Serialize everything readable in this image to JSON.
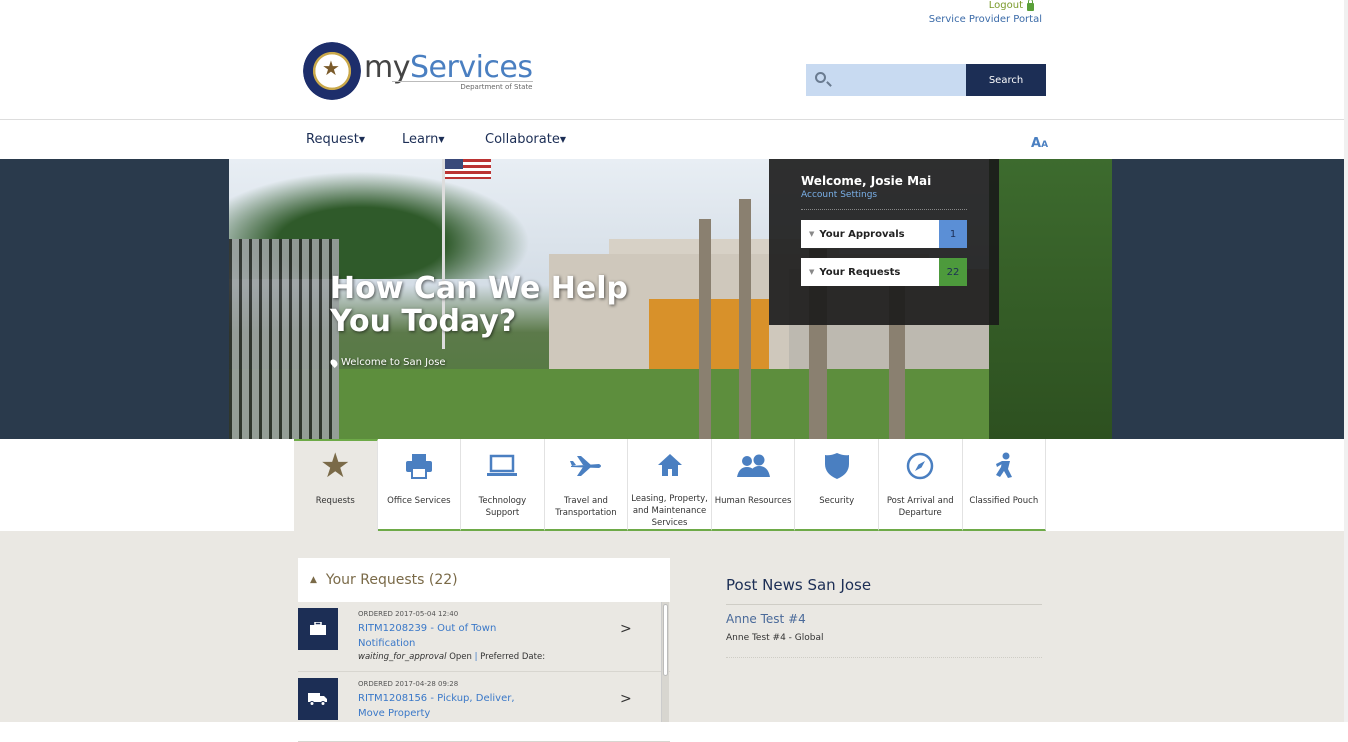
{
  "header": {
    "logout_label": "Logout",
    "service_provider_label": "Service Provider Portal",
    "brand_my": "my",
    "brand_services": "Services",
    "brand_sub": "Department of State",
    "search_placeholder": "",
    "search_button": "Search"
  },
  "nav": {
    "items": [
      {
        "label": "Request"
      },
      {
        "label": "Learn"
      },
      {
        "label": "Collaborate"
      }
    ],
    "font_size_label_big": "A",
    "font_size_label_small": "A"
  },
  "hero": {
    "title": "How Can We Help You Today?",
    "location": "Welcome to San Jose"
  },
  "welcome": {
    "greeting": "Welcome, Josie Mai",
    "account_settings": "Account Settings",
    "approvals_label": "Your Approvals",
    "approvals_count": "1",
    "approvals_color": "#5b8fd6",
    "requests_label": "Your Requests",
    "requests_count": "22",
    "requests_color": "#4d9a3c"
  },
  "categories": [
    {
      "label": "Requests",
      "icon": "star-icon"
    },
    {
      "label": "Office Services",
      "icon": "printer-icon"
    },
    {
      "label": "Technology Support",
      "icon": "laptop-icon"
    },
    {
      "label": "Travel and Transportation",
      "icon": "airplane-icon"
    },
    {
      "label": "Leasing, Property, and Maintenance Services",
      "icon": "home-icon"
    },
    {
      "label": "Human Resources",
      "icon": "people-icon"
    },
    {
      "label": "Security",
      "icon": "shield-icon"
    },
    {
      "label": "Post Arrival and Departure",
      "icon": "compass-icon"
    },
    {
      "label": "Classified Pouch",
      "icon": "courier-icon"
    }
  ],
  "requests_panel": {
    "title": "Your Requests (22)",
    "items": [
      {
        "ordered": "ORDERED 2017-05-04 12:40",
        "link": "RITM1208239 - Out of Town Notification",
        "status": "waiting_for_approval",
        "state": "Open",
        "sep": "|",
        "preferred": "Preferred Date:",
        "icon": "briefcase-icon"
      },
      {
        "ordered": "ORDERED 2017-04-28 09:28",
        "link": "RITM1208156 - Pickup, Deliver, Move Property",
        "icon": "truck-icon"
      }
    ]
  },
  "news": {
    "title": "Post News San Jose",
    "items": [
      {
        "title": "Anne Test #4",
        "subtitle": "Anne Test #4 - Global"
      }
    ]
  },
  "colors": {
    "navy": "#1c2e55",
    "link_blue": "#3a78c8",
    "green_accent": "#6eaa48",
    "tan_text": "#7a6a48"
  }
}
